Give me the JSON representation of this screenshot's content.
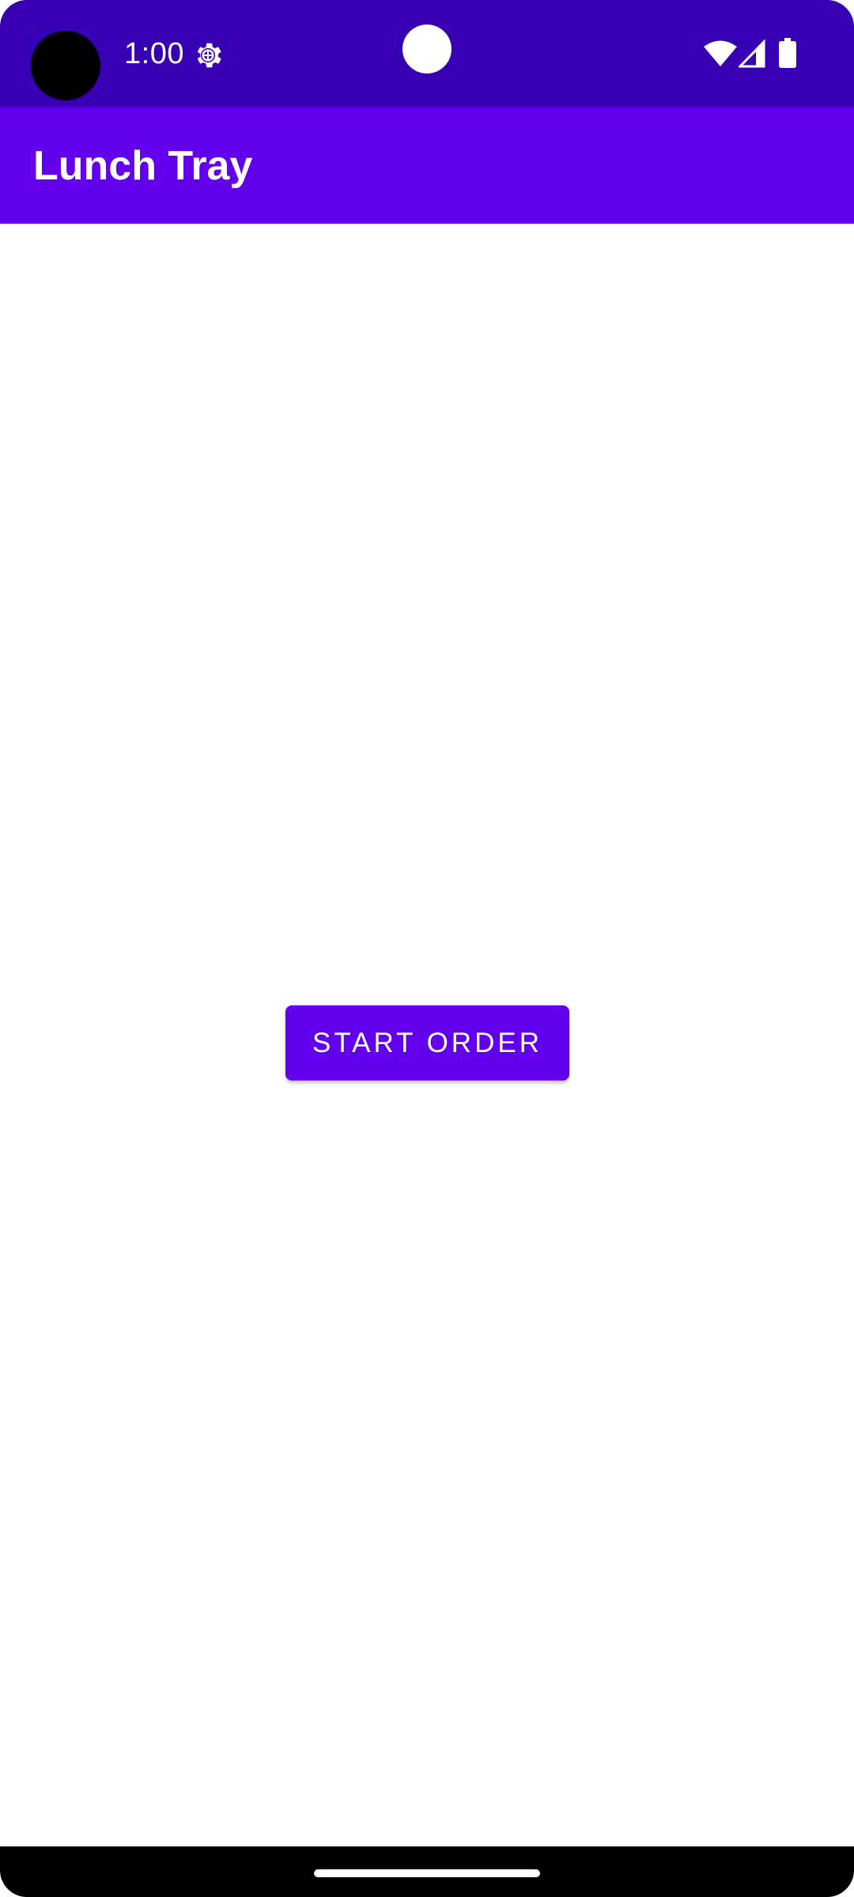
{
  "status_bar": {
    "time": "1:00",
    "icons": [
      "gear-icon",
      "wifi-icon",
      "signal-icon",
      "battery-icon"
    ],
    "color": "#3700b3"
  },
  "app_bar": {
    "title": "Lunch Tray",
    "color": "#6200ee"
  },
  "main": {
    "start_order_label": "START ORDER",
    "button_color": "#6200ee"
  },
  "nav_bar": {
    "color": "#000000",
    "handle": "home-handle"
  }
}
